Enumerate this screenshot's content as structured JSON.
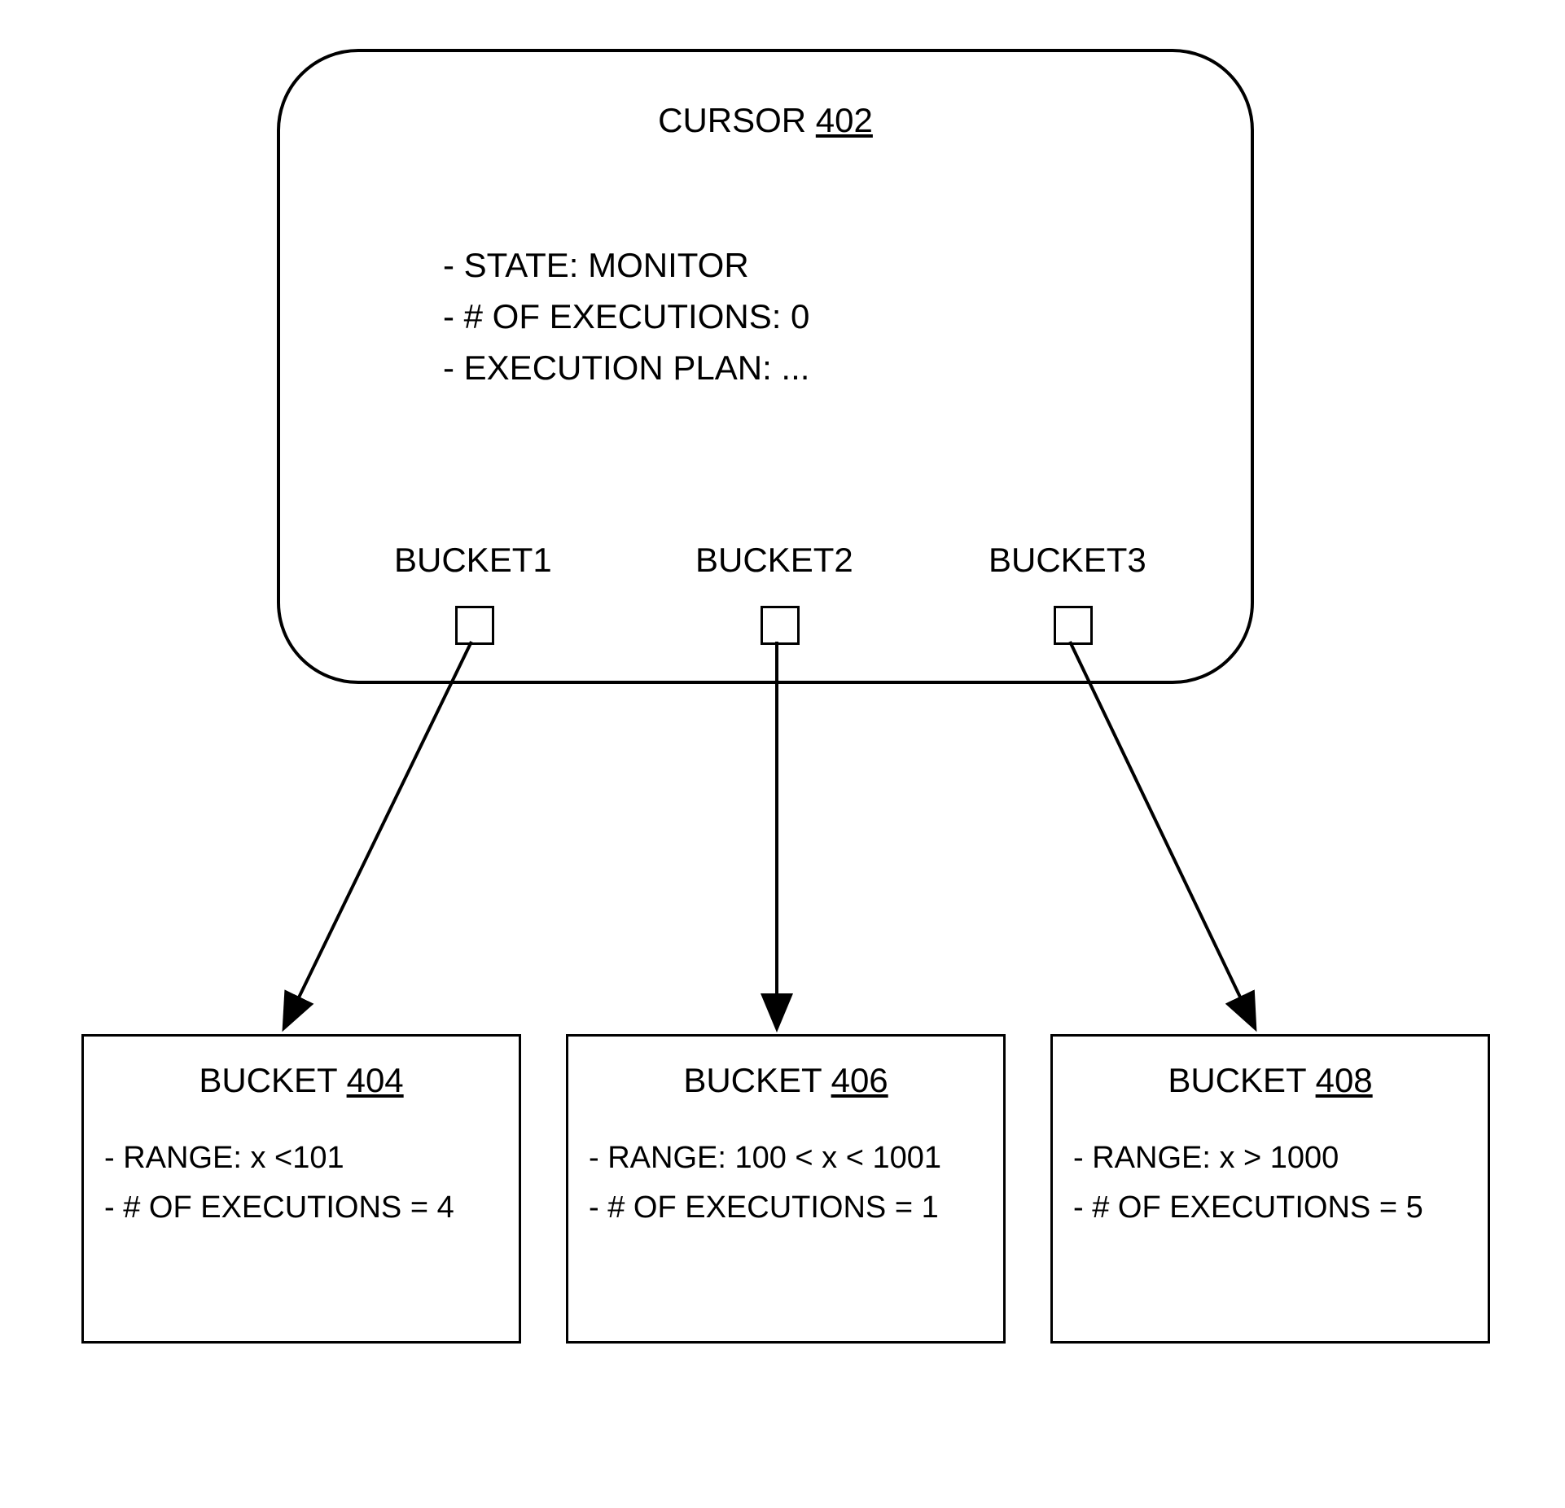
{
  "cursor": {
    "title_prefix": "CURSOR",
    "title_ref": "402",
    "state_line": "- STATE: MONITOR",
    "executions_line": "- # OF EXECUTIONS: 0",
    "plan_line": "- EXECUTION PLAN: ...",
    "bucket_labels": [
      "BUCKET1",
      "BUCKET2",
      "BUCKET3"
    ]
  },
  "buckets": [
    {
      "title_prefix": "BUCKET",
      "title_ref": "404",
      "range_line": "- RANGE: x <101",
      "exec_line": "- # OF EXECUTIONS = 4"
    },
    {
      "title_prefix": "BUCKET",
      "title_ref": "406",
      "range_line": "- RANGE: 100 < x < 1001",
      "exec_line": "- # OF EXECUTIONS = 1"
    },
    {
      "title_prefix": "BUCKET",
      "title_ref": "408",
      "range_line": "- RANGE: x > 1000",
      "exec_line": "- # OF EXECUTIONS = 5"
    }
  ]
}
